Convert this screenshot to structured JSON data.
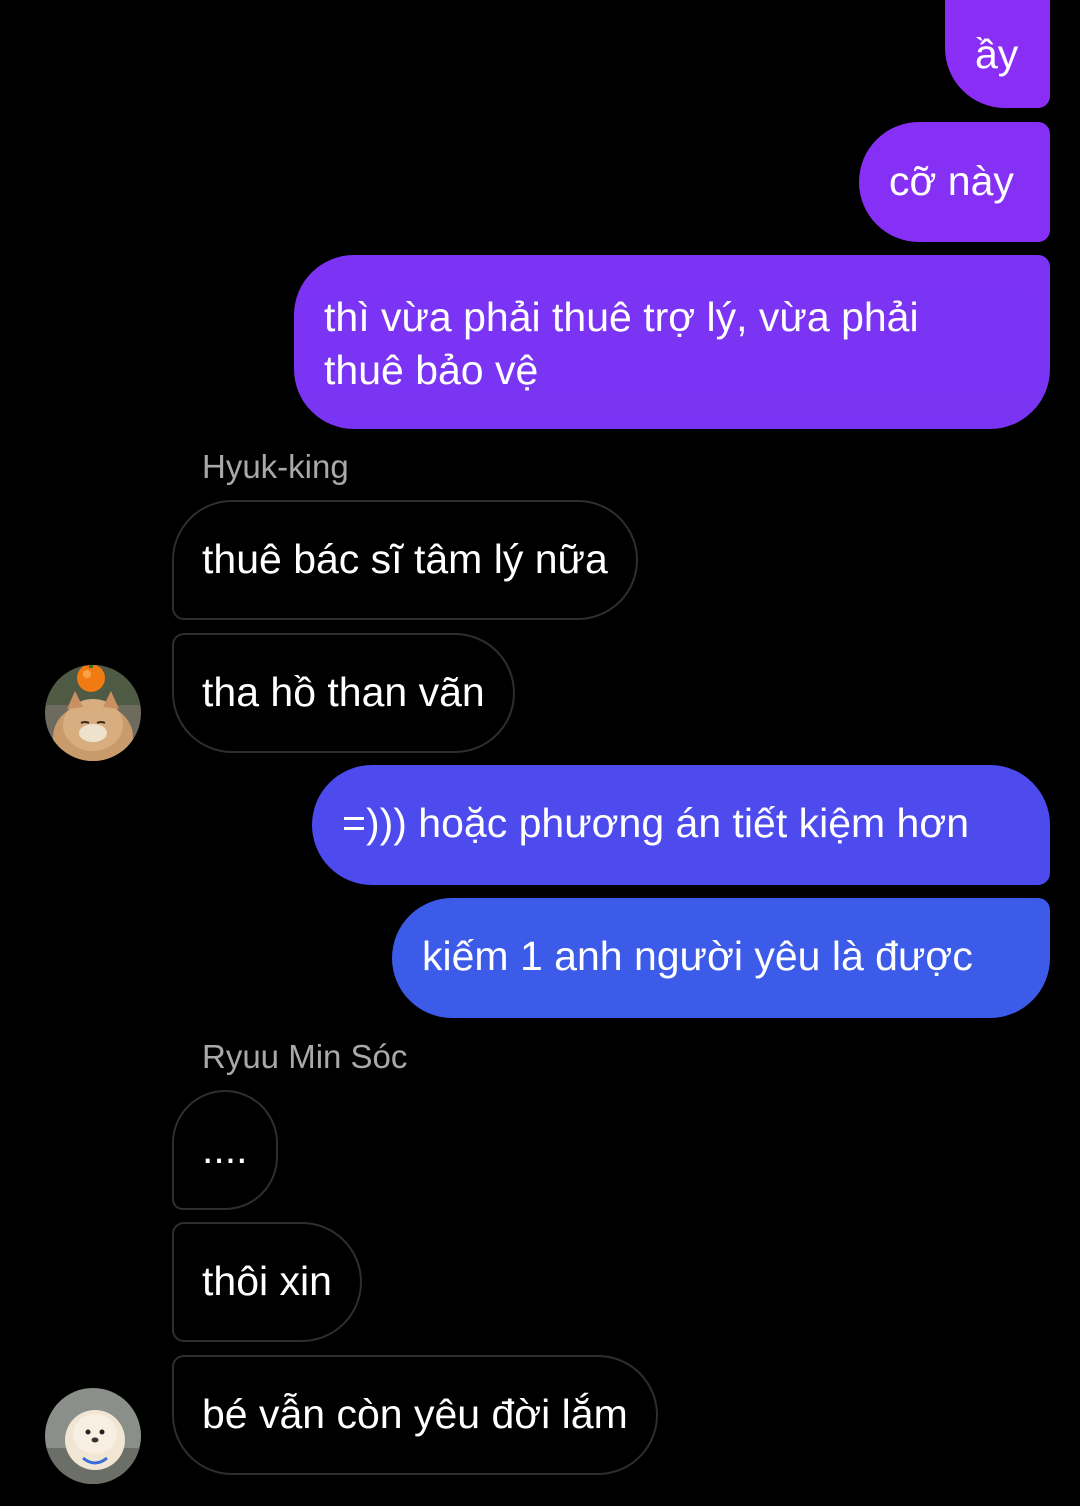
{
  "messages": [
    {
      "text": "ầy"
    },
    {
      "text": "cỡ này"
    },
    {
      "text_line1": "thì vừa phải thuê trợ lý, vừa phải",
      "text_line2": "thuê bảo vệ"
    },
    {
      "sender": "Hyuk-king"
    },
    {
      "text": "thuê bác sĩ tâm lý nữa"
    },
    {
      "text": "tha hồ than vãn"
    },
    {
      "text": "=))) hoặc phương án tiết kiệm hơn"
    },
    {
      "text": "kiếm 1 anh người yêu là được"
    },
    {
      "sender": "Ryuu Min Sóc"
    },
    {
      "text": "...."
    },
    {
      "text": "thôi xin"
    },
    {
      "text": "bé vẫn còn yêu đời lắm"
    }
  ],
  "avatars": [
    {
      "icon": "cat-with-orange-avatar-icon"
    },
    {
      "icon": "white-puppy-avatar-icon"
    }
  ],
  "colors": {
    "background": "#000000",
    "outgoing_top": "#8a2ef6",
    "outgoing_mid": "#6a3cf0",
    "outgoing_bottom": "#3c5be8",
    "incoming_border": "#2e2e2e",
    "sender_name": "#a9a9a9"
  }
}
